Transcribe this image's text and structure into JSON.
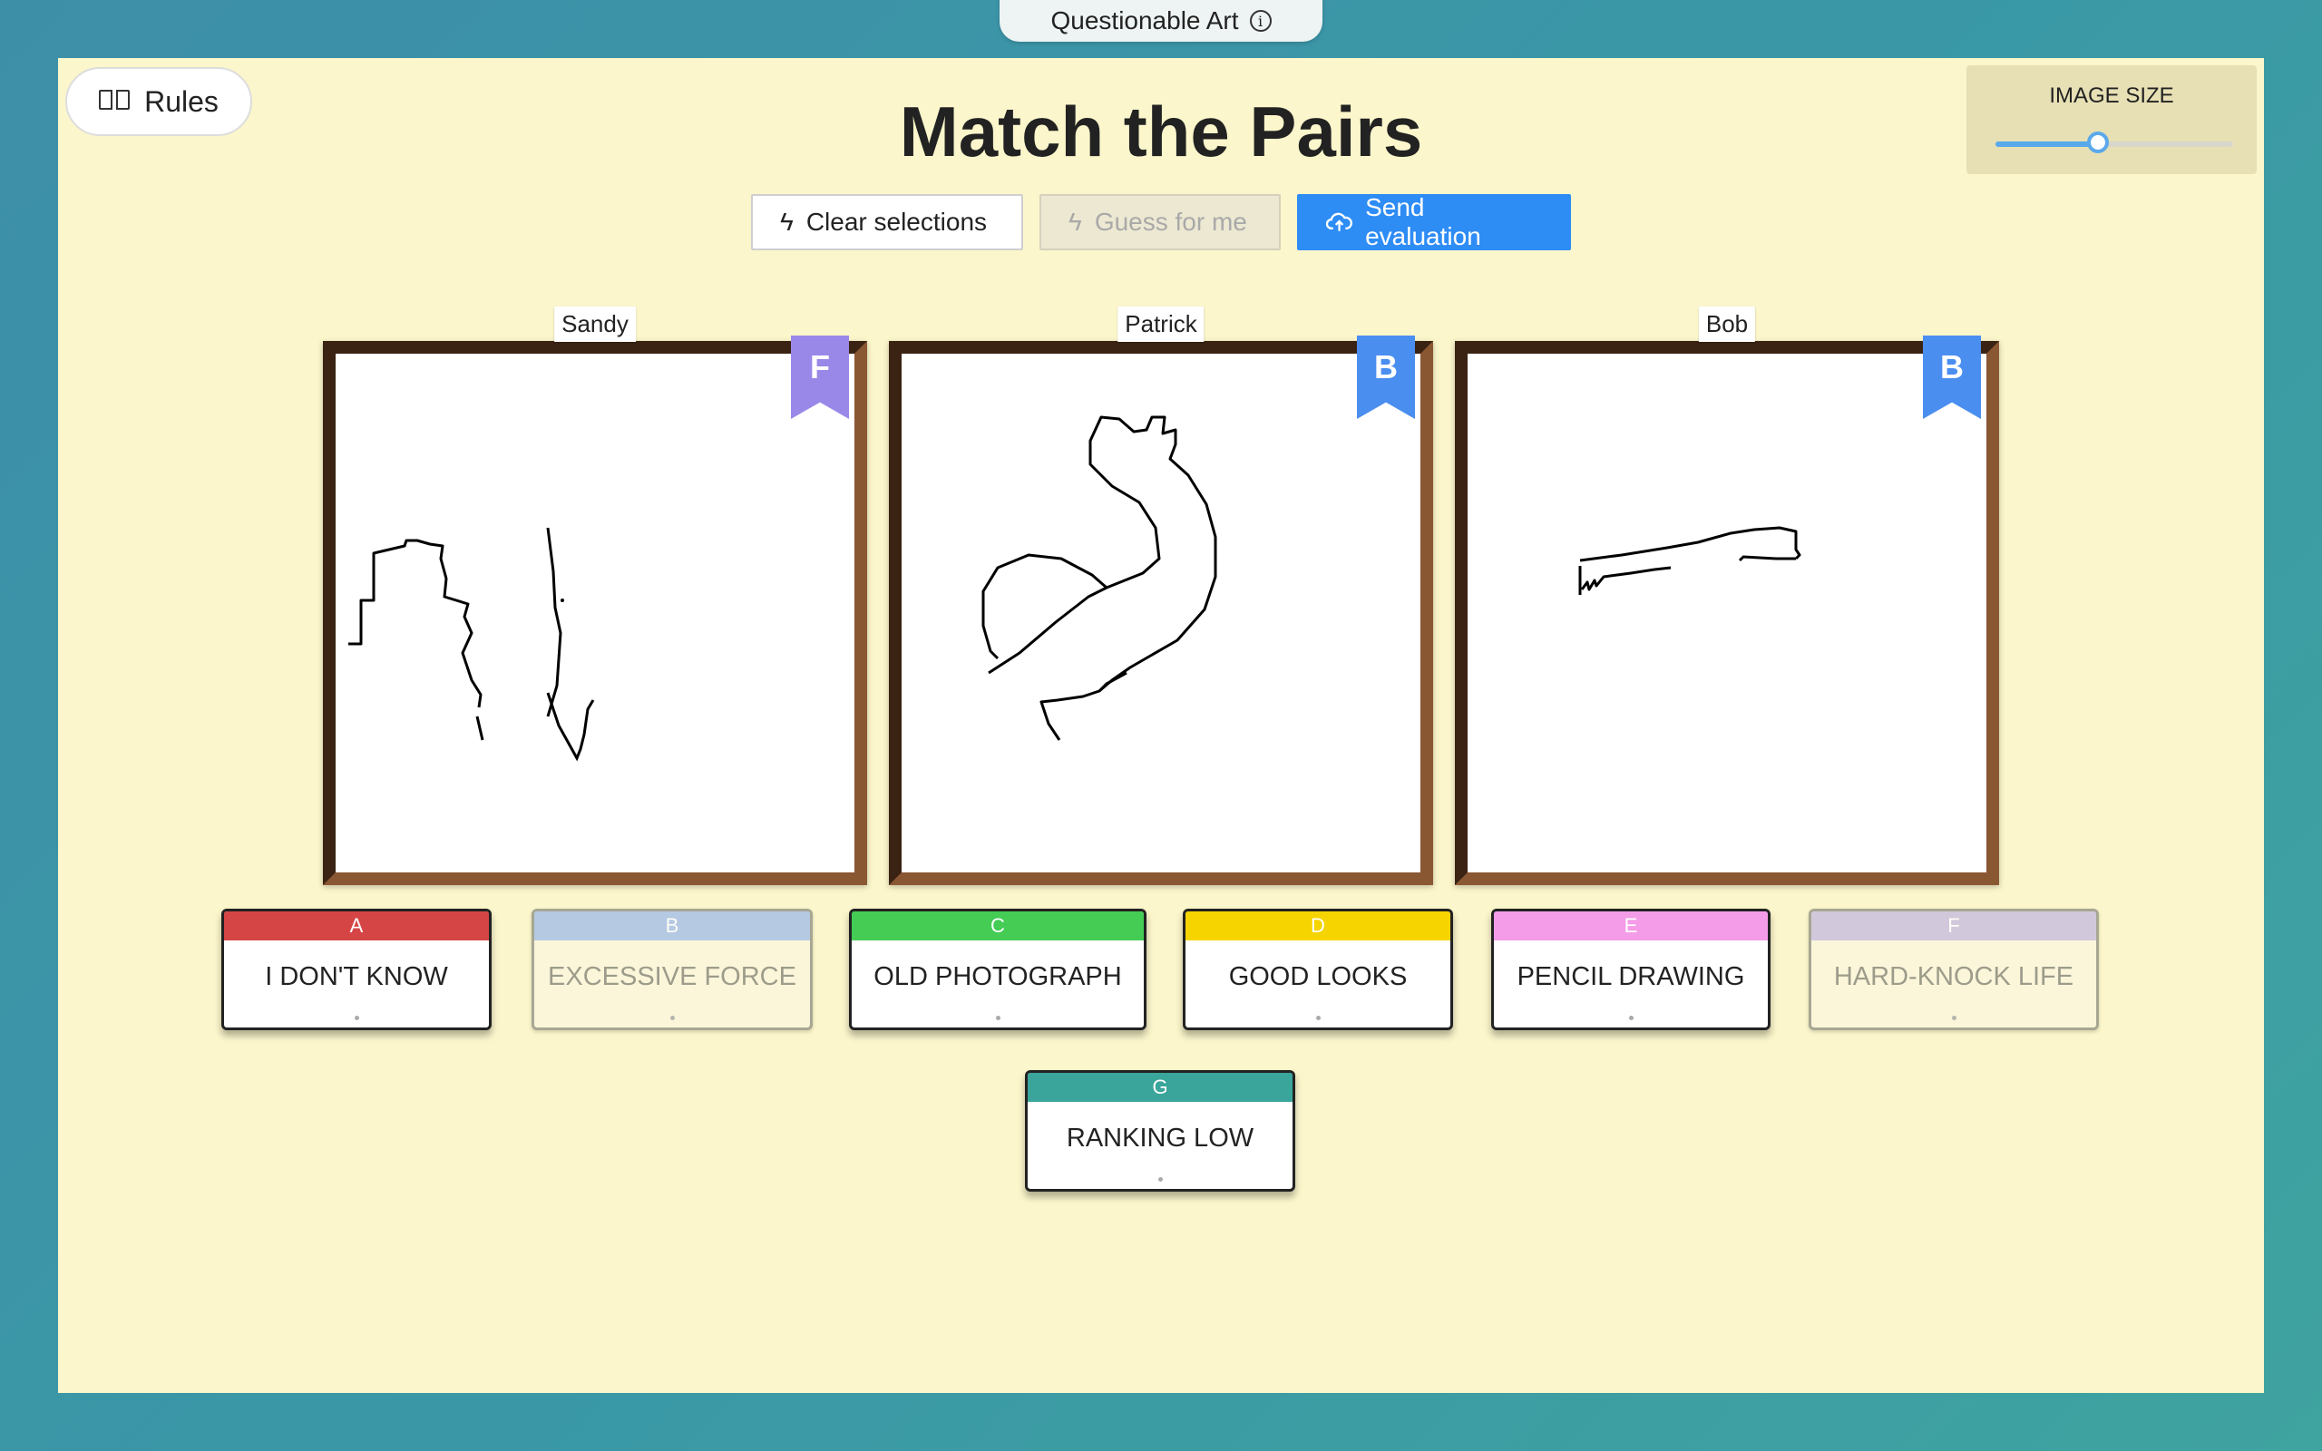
{
  "app": {
    "title": "Questionable Art"
  },
  "rules_button": {
    "label": "Rules"
  },
  "page_title": "Match the Pairs",
  "image_size": {
    "label": "IMAGE SIZE",
    "value_fraction": 0.43
  },
  "actions": {
    "clear": "Clear selections",
    "guess": "Guess for me",
    "send": "Send evaluation"
  },
  "drawings": [
    {
      "artist": "Sandy",
      "ribbon": "F",
      "ribbon_color": "#9a88e8"
    },
    {
      "artist": "Patrick",
      "ribbon": "B",
      "ribbon_color": "#4a8ef0"
    },
    {
      "artist": "Bob",
      "ribbon": "B",
      "ribbon_color": "#4a8ef0"
    }
  ],
  "cards": [
    {
      "letter": "A",
      "text": "I DON'T KNOW",
      "color": "#d64545",
      "used": false
    },
    {
      "letter": "B",
      "text": "EXCESSIVE FORCE",
      "color": "#a9c2e8",
      "used": true
    },
    {
      "letter": "C",
      "text": "OLD PHOTOGRAPH",
      "color": "#44cc55",
      "used": false
    },
    {
      "letter": "D",
      "text": "GOOD LOOKS",
      "color": "#f5d400",
      "used": false
    },
    {
      "letter": "E",
      "text": "PENCIL DRAWING",
      "color": "#f59ce8",
      "used": false
    },
    {
      "letter": "F",
      "text": "HARD-KNOCK LIFE",
      "color": "#cbc0e0",
      "used": true
    },
    {
      "letter": "G",
      "text": "RANKING LOW",
      "color": "#3aa59a",
      "used": false
    }
  ]
}
